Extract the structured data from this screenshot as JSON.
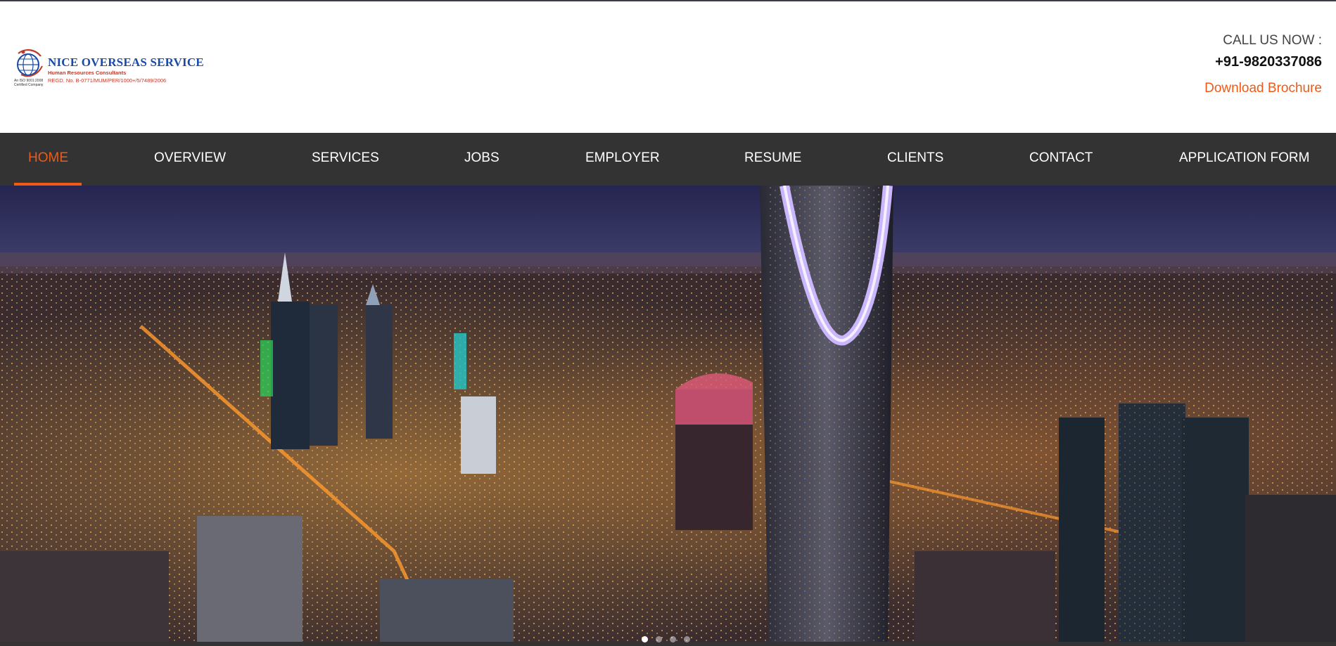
{
  "header": {
    "logo": {
      "name": "NICE OVERSEAS SERVICE",
      "tagline": "Human Resources Consultants",
      "registration": "REGD. No. B-0771/MUM/PER/1000+/5/7489/2006",
      "certification": "An ISO 9001:2008 Certified Company"
    },
    "contact": {
      "call_label": "CALL US NOW :",
      "phone": "+91-9820337086",
      "brochure_label": "Download Brochure"
    }
  },
  "nav": {
    "items": [
      {
        "label": "HOME",
        "active": true
      },
      {
        "label": "OVERVIEW",
        "active": false
      },
      {
        "label": "SERVICES",
        "active": false
      },
      {
        "label": "JOBS",
        "active": false
      },
      {
        "label": "EMPLOYER",
        "active": false
      },
      {
        "label": "RESUME",
        "active": false
      },
      {
        "label": "CLIENTS",
        "active": false
      },
      {
        "label": "CONTACT",
        "active": false
      },
      {
        "label": "APPLICATION FORM",
        "active": false
      }
    ]
  },
  "hero": {
    "description_icon": "city-skyline-night-image",
    "slides": {
      "count": 4,
      "active_index": 0
    }
  },
  "colors": {
    "accent": "#f05a14",
    "nav_background": "#333333",
    "logo_blue": "#1a4aa8",
    "logo_red": "#c0392b"
  }
}
